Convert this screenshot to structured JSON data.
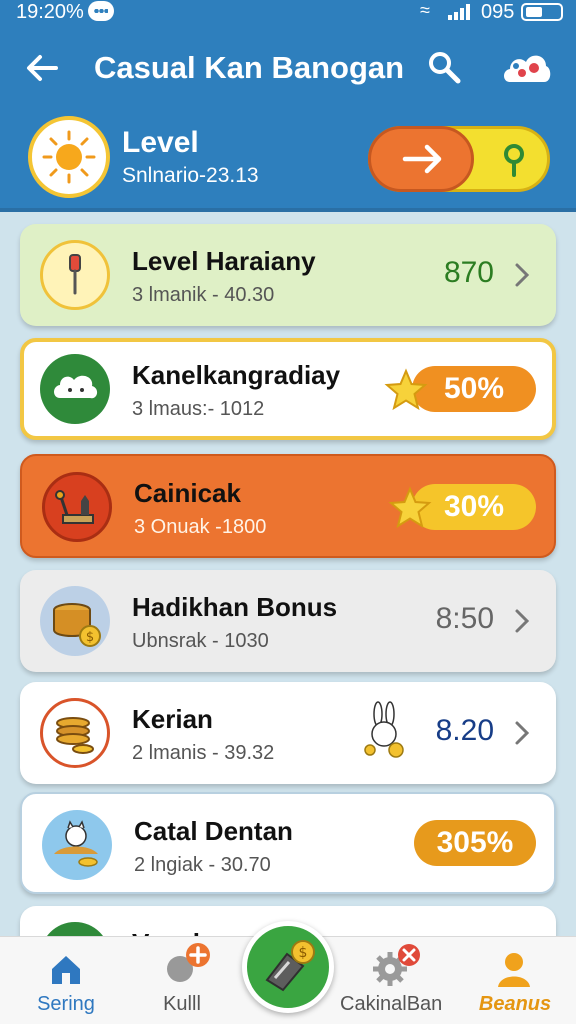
{
  "status_bar": {
    "time": "19:20%",
    "battery_text": "095",
    "icons": [
      "chat-icon",
      "wifi-icon",
      "signal-icon",
      "battery-icon"
    ]
  },
  "header": {
    "title": "Casual Kan Banogan",
    "icons": [
      "back-arrow-icon",
      "search-icon",
      "cloud-icon"
    ]
  },
  "profile": {
    "level_label": "Level",
    "subtitle": "Snlnario-23.13",
    "avatar_icon": "sun-icon",
    "toggle_icons": [
      "arrow-right-icon",
      "pin-icon"
    ]
  },
  "list": [
    {
      "title": "Level Haraiany",
      "subtitle": "3 lmanik - 40.30",
      "value": "870",
      "icon": "thermometer-icon"
    },
    {
      "title": "Kanelkangradiay",
      "subtitle": "3 lmaus:- 1012",
      "value": "50%",
      "icon": "cloud-face-icon",
      "badge": "star-icon"
    },
    {
      "title": "Cainicak",
      "subtitle": "3 Onuak -1800",
      "value": "30%",
      "icon": "cat-icon",
      "badge": "star-icon"
    },
    {
      "title": "Hadikhan Bonus",
      "subtitle": "Ubnsrak - 1030",
      "value": "8:50",
      "icon": "coin-drum-icon"
    },
    {
      "title": "Kerian",
      "subtitle": "2 lmanis - 39.32",
      "value": "8.20",
      "icon": "coin-stack-icon",
      "badge": "bunny-icon"
    },
    {
      "title": "Catal Dentan",
      "subtitle": "2 lngiak - 30.70",
      "value": "305%",
      "icon": "cat-coin-icon"
    },
    {
      "title": "Vanal",
      "subtitle": "",
      "value": "",
      "icon": "leaf-icon"
    }
  ],
  "bottom_nav": [
    {
      "label": "Sering",
      "icon": "home-icon"
    },
    {
      "label": "Kulll",
      "icon": "ball-icon"
    },
    {
      "label": "",
      "icon": "coin-note-icon"
    },
    {
      "label": "CakinalBan",
      "icon": "gear-icon"
    },
    {
      "label": "Beanus",
      "icon": "person-icon"
    }
  ],
  "colors": {
    "header": "#2e7fbd",
    "orange": "#ec7430",
    "yellow": "#f3df2f",
    "green": "#3aa541",
    "pale_green": "#dff0c6"
  }
}
